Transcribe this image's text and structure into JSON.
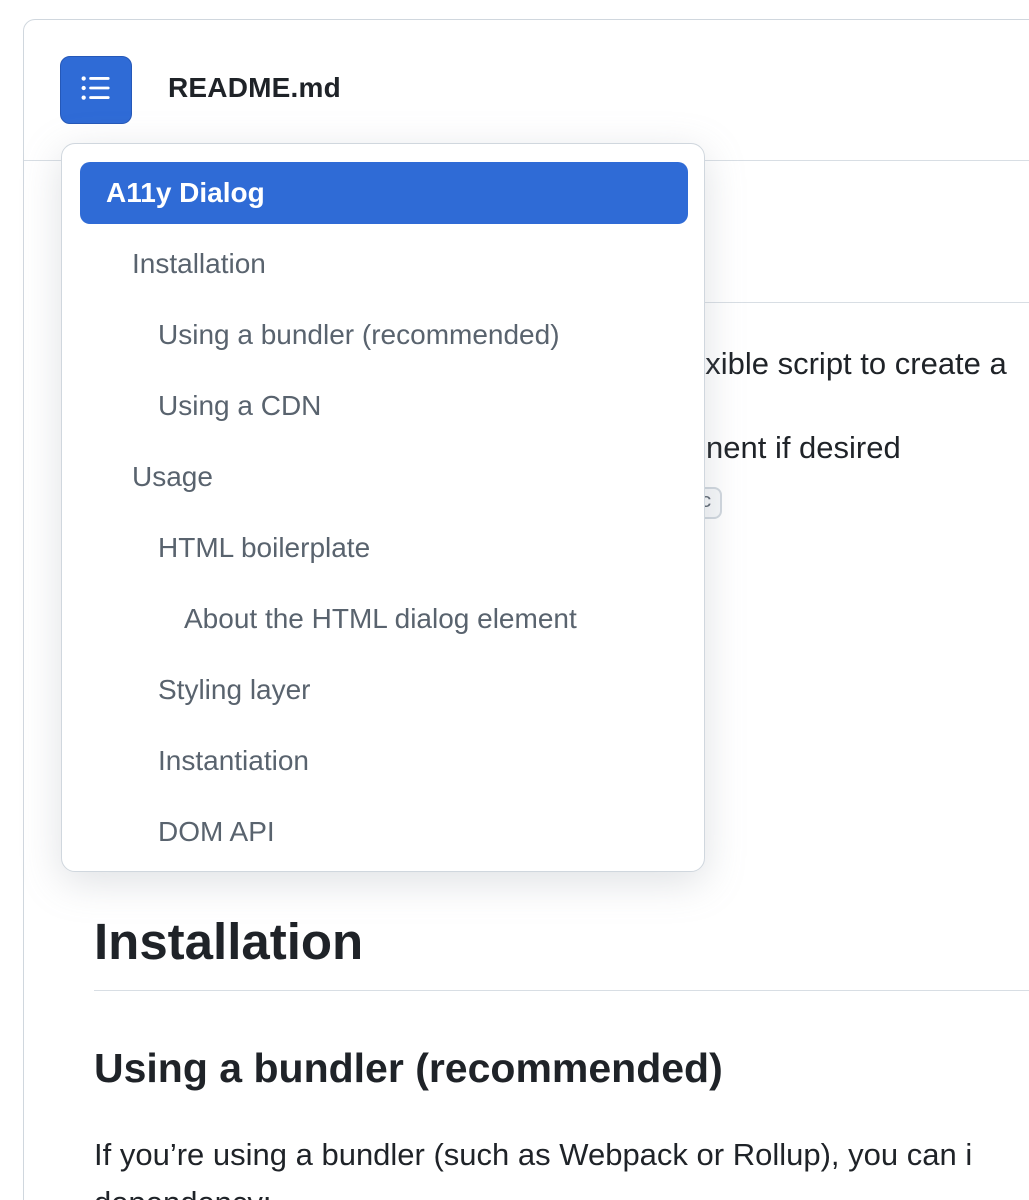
{
  "file_header": {
    "title": "README.md",
    "toc_icon": "list-unordered-icon"
  },
  "toc": {
    "items": [
      {
        "label": "A11y Dialog",
        "active": true
      },
      {
        "label": "Installation",
        "active": false
      },
      {
        "label": "Using a bundler (recommended)",
        "active": false
      },
      {
        "label": "Using a CDN",
        "active": false
      },
      {
        "label": "Usage",
        "active": false
      },
      {
        "label": "HTML boilerplate",
        "active": false
      },
      {
        "label": "About the HTML dialog element",
        "active": false
      },
      {
        "label": "Styling layer",
        "active": false
      },
      {
        "label": "Instantiation",
        "active": false
      },
      {
        "label": "DOM API",
        "active": false
      }
    ]
  },
  "article": {
    "partial_line_1": "exible script to create a",
    "partial_line_2": "nent if desired",
    "chip_text": "c",
    "heading_installation": "Installation",
    "heading_bundler": "Using a bundler (recommended)",
    "paragraph": "If you’re using a bundler (such as Webpack or Rollup), you can i",
    "paragraph_2": "dependency:"
  },
  "colors": {
    "accent": "#2f6bd6",
    "text_primary": "#1f2328",
    "text_muted": "#59636e",
    "border": "#d0d7de"
  }
}
